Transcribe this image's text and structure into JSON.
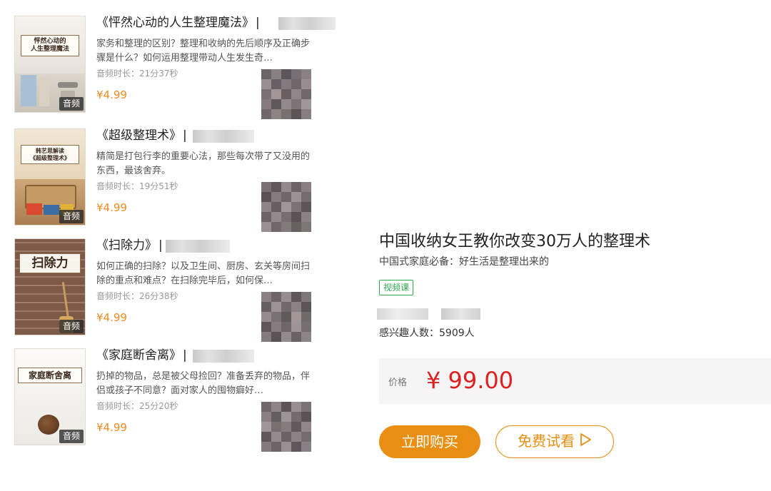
{
  "courses": [
    {
      "title": "《怦然心动的人生整理魔法》",
      "description": "家务和整理的区别？整理和收纳的先后顺序及正确步骤是什么？如何运用整理带动人生发生奇…",
      "duration": "音频时长：21分37秒",
      "price": "¥4.99",
      "badge": "音频",
      "cover_title": "怦然心动的\n人生整理魔法",
      "cover_colors": [
        "#f4f1ea",
        "#e3ded3"
      ]
    },
    {
      "title": "《超级整理术》",
      "description": "精简是打包行李的重要心法，那些每次带了又没用的东西，最该舍弃。",
      "duration": "音频时长：19分51秒",
      "price": "¥4.99",
      "badge": "音频",
      "cover_title": "韩艺思解读\n《超级整理术》",
      "cover_colors": [
        "#efe3cc",
        "#b48b57"
      ]
    },
    {
      "title": "《扫除力》",
      "description": "如何正确的扫除？以及卫生间、厨房、玄关等房间扫除的重点和难点？在扫除完毕后，如何保…",
      "duration": "音频时长：26分38秒",
      "price": "¥4.99",
      "badge": "音频",
      "cover_title": "扫除力",
      "cover_colors": [
        "#8e6b58",
        "#6f4f3f"
      ]
    },
    {
      "title": "《家庭断舍离》",
      "description": "扔掉的物品，总是被父母捡回？准备丢弃的物品，伴侣或孩子不同意？面对家人的囤物癖好…",
      "duration": "音频时长：25分20秒",
      "price": "¥4.99",
      "badge": "音频",
      "cover_title": "家庭断舍离",
      "cover_colors": [
        "#f7f6f3",
        "#ecebe7"
      ]
    }
  ],
  "detail": {
    "title": "中国收纳女王教你改变30万人的整理术",
    "subtitle": "中国式家庭必备：好生活是整理出来的",
    "tag": "视频课",
    "interest_count": "感兴趣人数：5909人",
    "price_label": "价格",
    "price": "¥ 99.00",
    "buy_button": "立即购买",
    "trial_button": "免费试看"
  },
  "colors": {
    "accent": "#e88e12",
    "price_red": "#e02020",
    "list_price": "#f08a24",
    "tag_green": "#2fa84f"
  },
  "icons": {
    "trial": "play-triangle-icon"
  }
}
